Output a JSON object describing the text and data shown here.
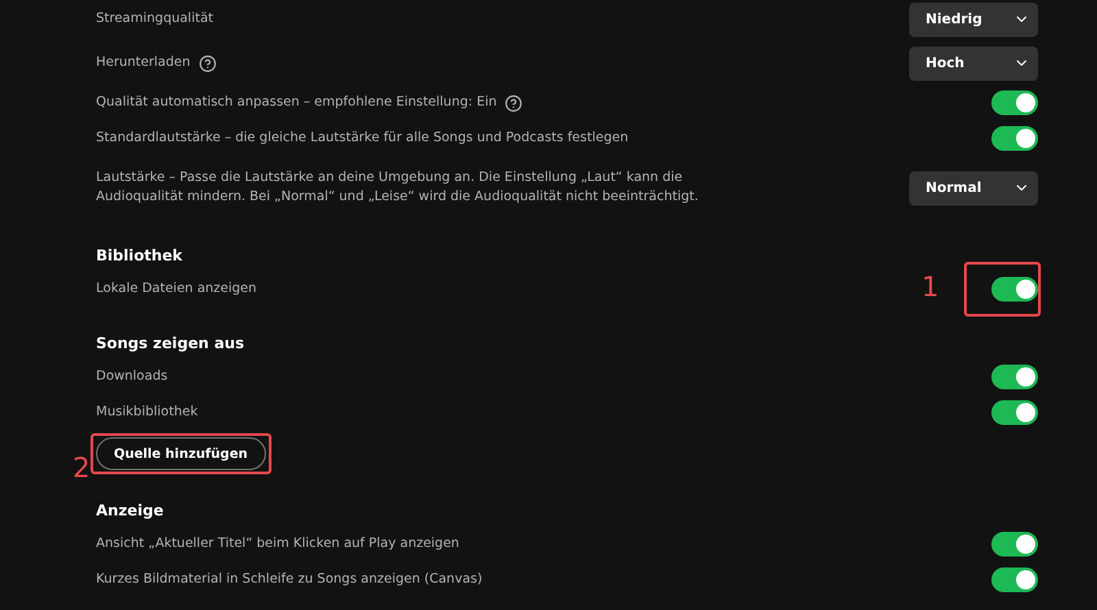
{
  "sections": [
    {
      "items": [
        {
          "kind": "select",
          "label": "Streamingqualität",
          "value": "Niedrig"
        },
        {
          "kind": "select",
          "label": "Herunterladen",
          "help": true,
          "value": "Hoch"
        },
        {
          "kind": "toggle",
          "label": "Qualität automatisch anpassen – empfohlene Einstellung: Ein",
          "help": true,
          "on": true
        },
        {
          "kind": "toggle",
          "label": "Standardlautstärke – die gleiche Lautstärke für alle Songs und Podcasts festlegen",
          "on": true
        },
        {
          "kind": "select",
          "label": "Lautstärke – Passe die Lautstärke an deine Umgebung an. Die Einstellung „Laut“ kann die Audioqualität mindern. Bei „Normal“ und „Leise“ wird die Audioqualität nicht beeinträchtigt.",
          "value": "Normal"
        }
      ]
    },
    {
      "heading": "Bibliothek",
      "items": [
        {
          "kind": "toggle",
          "label": "Lokale Dateien anzeigen",
          "on": true,
          "annotation": "1"
        }
      ]
    },
    {
      "heading": "Songs zeigen aus",
      "items": [
        {
          "kind": "toggle",
          "label": "Downloads",
          "on": true
        },
        {
          "kind": "toggle",
          "label": "Musikbibliothek",
          "on": true
        },
        {
          "kind": "button",
          "label": "Quelle hinzufügen",
          "annotation": "2"
        }
      ]
    },
    {
      "heading": "Anzeige",
      "items": [
        {
          "kind": "toggle",
          "label": "Ansicht „Aktueller Titel“ beim Klicken auf Play anzeigen",
          "on": true
        },
        {
          "kind": "toggle",
          "label": "Kurzes Bildmaterial in Schleife zu Songs anzeigen (Canvas)",
          "on": true
        }
      ]
    }
  ]
}
